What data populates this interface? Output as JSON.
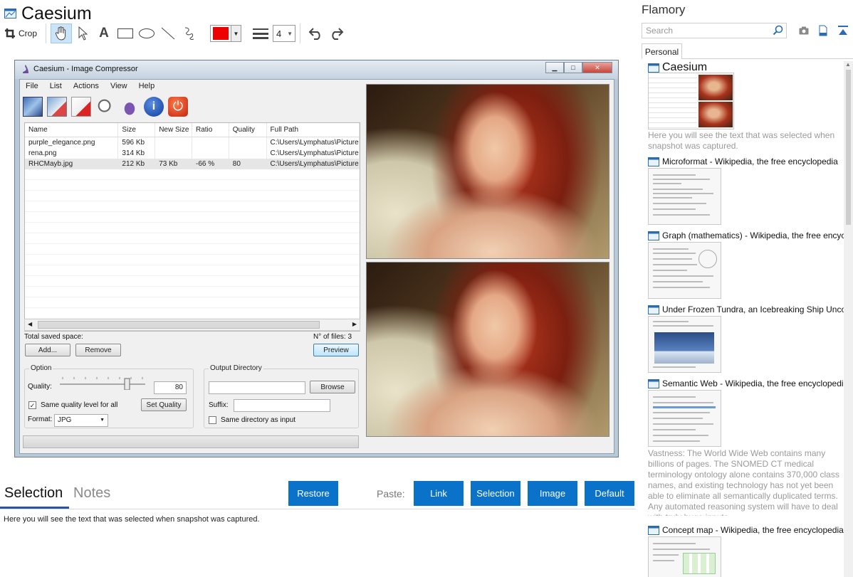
{
  "app": {
    "title": "Caesium"
  },
  "toolbar": {
    "crop_label": "Crop",
    "line_width": "4",
    "color": "#ee0000",
    "tools": [
      "hand-icon",
      "pointer-icon",
      "text-icon",
      "rectangle-icon",
      "ellipse-icon",
      "line-icon",
      "freehand-icon"
    ]
  },
  "screenshot": {
    "window_title": "Caesium - Image Compressor",
    "menu": [
      "File",
      "List",
      "Actions",
      "View",
      "Help"
    ],
    "columns": [
      "Name",
      "Size",
      "New Size",
      "Ratio",
      "Quality",
      "Full Path"
    ],
    "rows": [
      [
        "purple_elegance.png",
        "596 Kb",
        "",
        "",
        "",
        "C:\\Users\\Lymphatus\\Pictures"
      ],
      [
        "rena.png",
        "314 Kb",
        "",
        "",
        "",
        "C:\\Users\\Lymphatus\\Pictures"
      ],
      [
        "RHCMayb.jpg",
        "212 Kb",
        "73 Kb",
        "-66 %",
        "80",
        "C:\\Users\\Lymphatus\\Pictures"
      ]
    ],
    "total_saved": "Total saved space:",
    "num_files": "N° of files: 3",
    "add": "Add...",
    "remove": "Remove",
    "preview": "Preview",
    "option_group": "Option",
    "quality_label": "Quality:",
    "quality_value": "80",
    "same_quality": "Same quality level for all",
    "set_quality": "Set Quality",
    "format_label": "Format:",
    "format_value": "JPG",
    "output_group": "Output Directory",
    "browse": "Browse",
    "suffix_label": "Suffix:",
    "same_dir": "Same directory as input"
  },
  "bottom": {
    "tab_selection": "Selection",
    "tab_notes": "Notes",
    "restore": "Restore",
    "paste_label": "Paste:",
    "paste_link": "Link",
    "paste_selection": "Selection",
    "paste_image": "Image",
    "paste_default": "Default",
    "note_text": "Here you will see the text that was selected when snapshot was captured."
  },
  "sidebar": {
    "title": "Flamory",
    "search_placeholder": "Search",
    "tab": "Personal",
    "cards": [
      {
        "title": "Caesium",
        "desc": "Here you will see the text that was selected when snapshot was captured."
      },
      {
        "title": "Microformat - Wikipedia, the free encyclopedia",
        "desc": ""
      },
      {
        "title": "Graph (mathematics) - Wikipedia, the free encyclopedia",
        "desc": ""
      },
      {
        "title": "Under Frozen Tundra, an Icebreaking Ship Uncovers",
        "desc": ""
      },
      {
        "title": "Semantic Web - Wikipedia, the free encyclopedia",
        "desc": "Vastness: The World Wide Web contains many billions of pages. The SNOMED CT medical terminology ontology alone contains 370,000 class names, and existing technology has not yet been able to eliminate all semantically duplicated terms. Any automated reasoning system will have to deal with truly huge inputs."
      },
      {
        "title": "Concept map - Wikipedia, the free encyclopedia",
        "desc": ""
      }
    ]
  }
}
